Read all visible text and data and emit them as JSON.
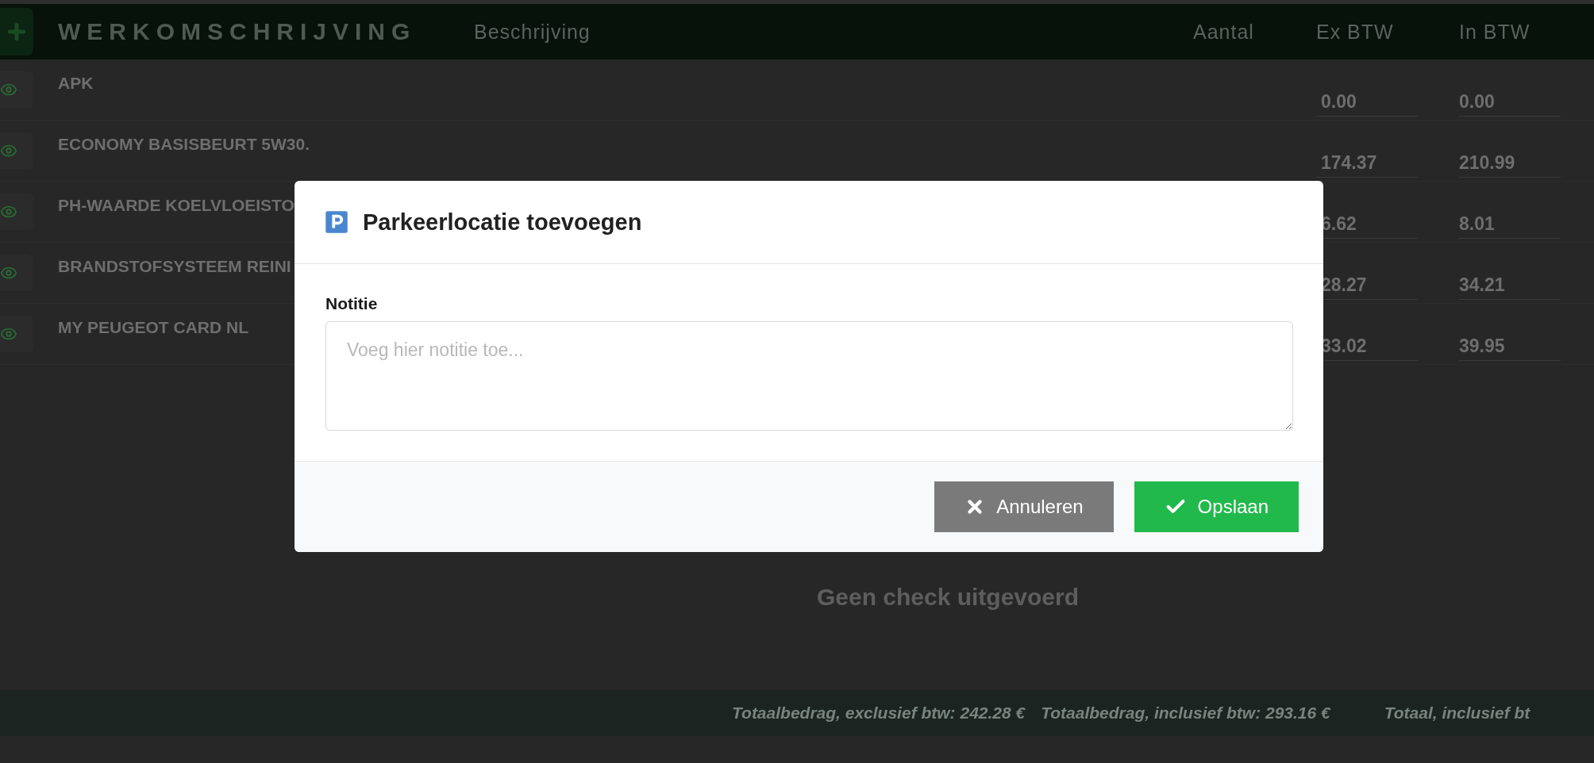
{
  "header": {
    "title": "WERKOMSCHRIJVING",
    "columns": [
      "Beschrijving",
      "Aantal",
      "Ex BTW",
      "In BTW"
    ]
  },
  "rows": [
    {
      "description": "APK",
      "ex_btw": "0.00",
      "in_btw": "0.00"
    },
    {
      "description": "ECONOMY BASISBEURT 5W30.",
      "ex_btw": "174.37",
      "in_btw": "210.99"
    },
    {
      "description": "PH-WAARDE KOELVLOEISTO",
      "ex_btw": "6.62",
      "in_btw": "8.01"
    },
    {
      "description": "BRANDSTOFSYSTEEM REINI",
      "ex_btw": "28.27",
      "in_btw": "34.21"
    },
    {
      "description": "MY PEUGEOT CARD NL",
      "ex_btw": "33.02",
      "in_btw": "39.95"
    }
  ],
  "empty_message": "Geen check uitgevoerd",
  "totals": [
    "Totaalbedrag, exclusief btw: 242.28 €",
    "Totaalbedrag, inclusief btw: 293.16 €",
    "Totaal, inclusief bt"
  ],
  "modal": {
    "title": "Parkeerlocatie toevoegen",
    "field_label": "Notitie",
    "placeholder": "Voeg hier notitie toe...",
    "buttons": [
      {
        "kind": "cancel",
        "label": "Annuleren"
      },
      {
        "kind": "save",
        "label": "Opslaan"
      }
    ]
  }
}
